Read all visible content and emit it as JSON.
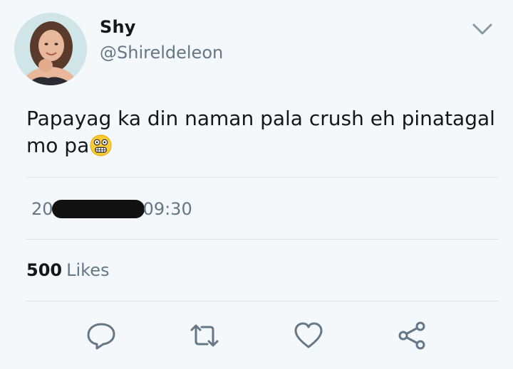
{
  "author": {
    "display_name": "Shy",
    "handle": "@Shireldeleon",
    "avatar_icon": "profile-photo"
  },
  "tweet": {
    "text": "Papayag ka din naman pala crush eh pinatagal mo pa",
    "emoji": "grimacing-face-emoji"
  },
  "timestamp": {
    "prefix": "20",
    "suffix": "09:30"
  },
  "stats": {
    "likes_count": "500",
    "likes_label": "Likes"
  },
  "actions": {
    "reply_icon": "reply-icon",
    "retweet_icon": "retweet-icon",
    "like_icon": "heart-icon",
    "share_icon": "share-icon"
  },
  "colors": {
    "background": "#f5f8fa",
    "secondary_text": "#657786",
    "primary_text": "#14171a",
    "divider": "#dfe3e6"
  }
}
